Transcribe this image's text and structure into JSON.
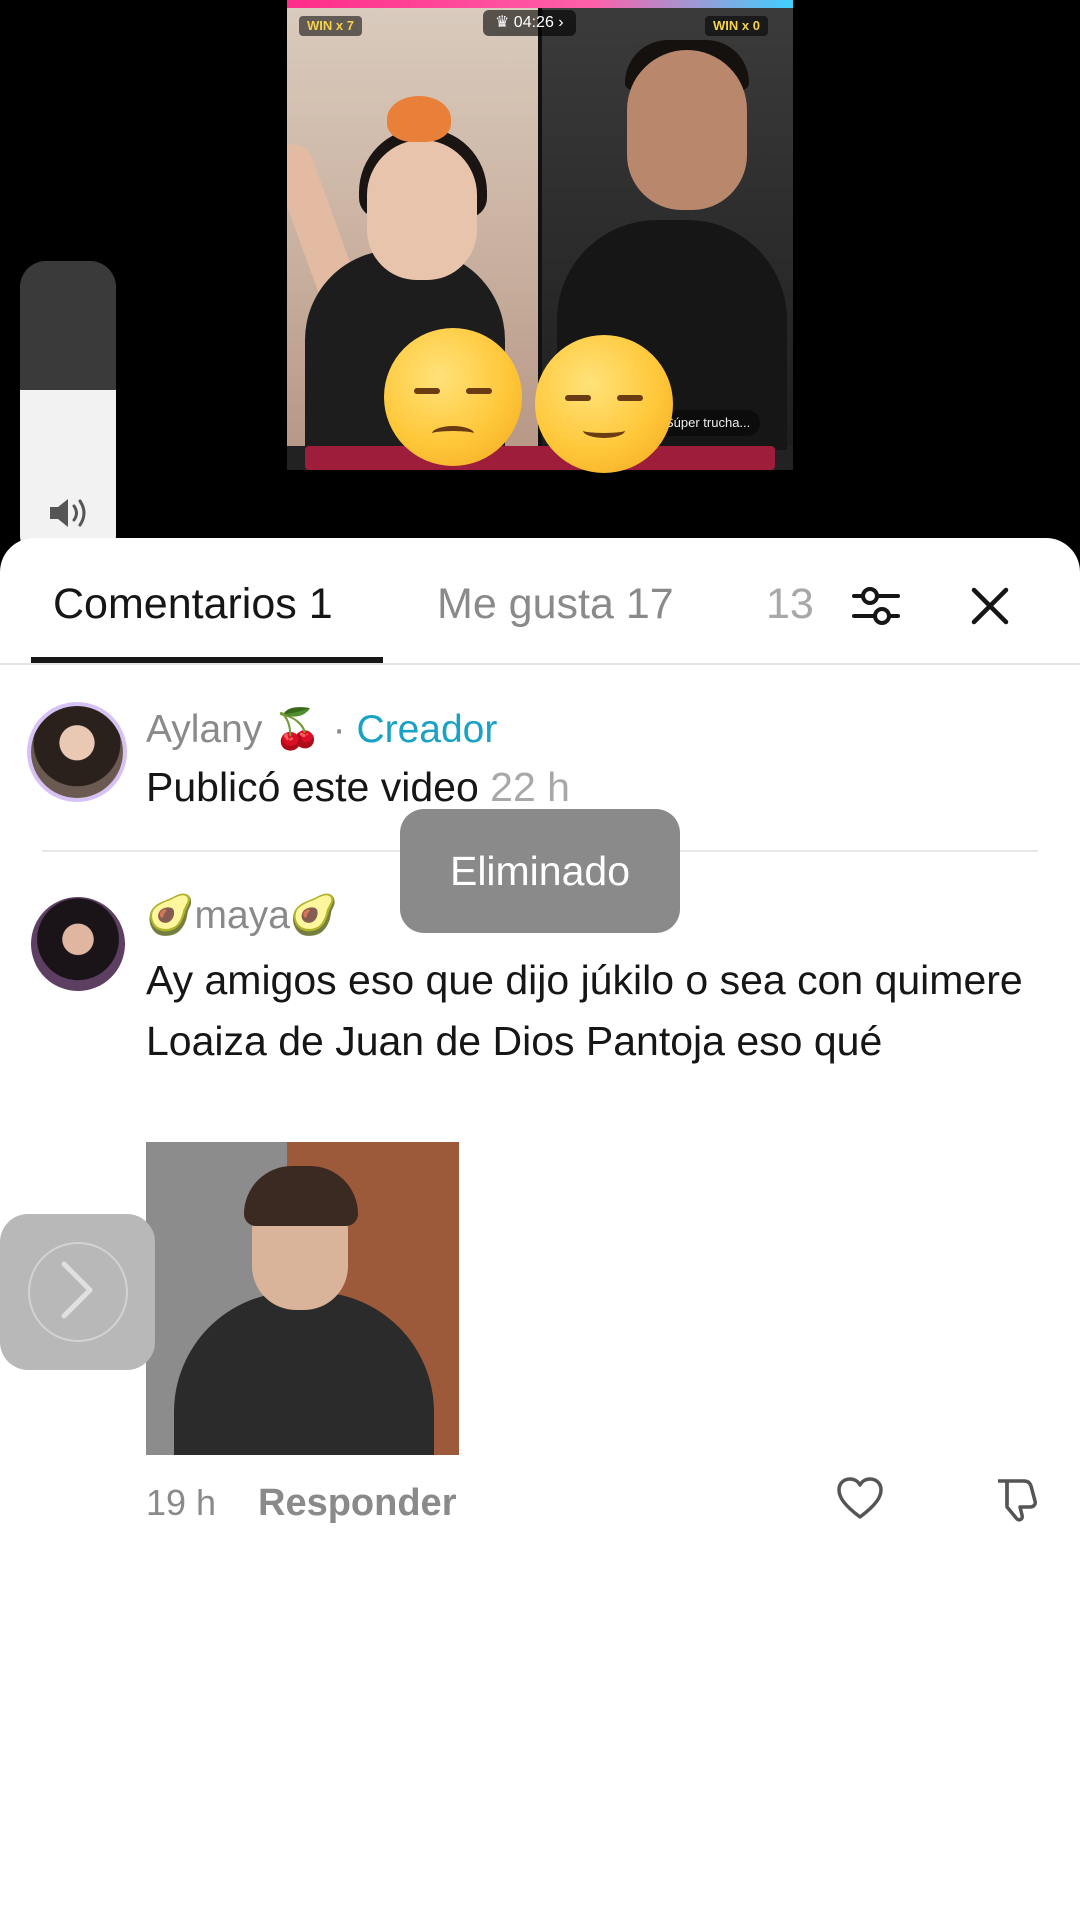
{
  "video": {
    "timer": "04:26",
    "win_left": "WIN x 7",
    "win_right": "WIN x 0",
    "caption": "Súper trucha..."
  },
  "volume": {
    "level": 0.57,
    "icon": "speaker-icon"
  },
  "tabs": [
    {
      "label": "Comentarios 1",
      "active": true
    },
    {
      "label": "Me gusta 17",
      "active": false
    },
    {
      "label": "13",
      "active": false
    }
  ],
  "toolbar": {
    "filter_icon": "sliders-icon",
    "close_icon": "close-icon"
  },
  "comments": [
    {
      "author": "Aylany 🍒",
      "separator": "·",
      "role": "Creador",
      "text": "Publicó este video",
      "time": "22 h"
    },
    {
      "author": "🥑maya🥑",
      "text": "Ay amigos eso que dijo júkilo o sea con quimere Loaiza de Juan de Dios Pantoja eso qué",
      "time": "19 h",
      "reply_label": "Responder",
      "attachment": "image"
    }
  ],
  "toast": {
    "text": "Eliminado"
  },
  "colors": {
    "creator": "#1aa2c4",
    "text": "#161616",
    "muted": "#8a8a8a"
  }
}
